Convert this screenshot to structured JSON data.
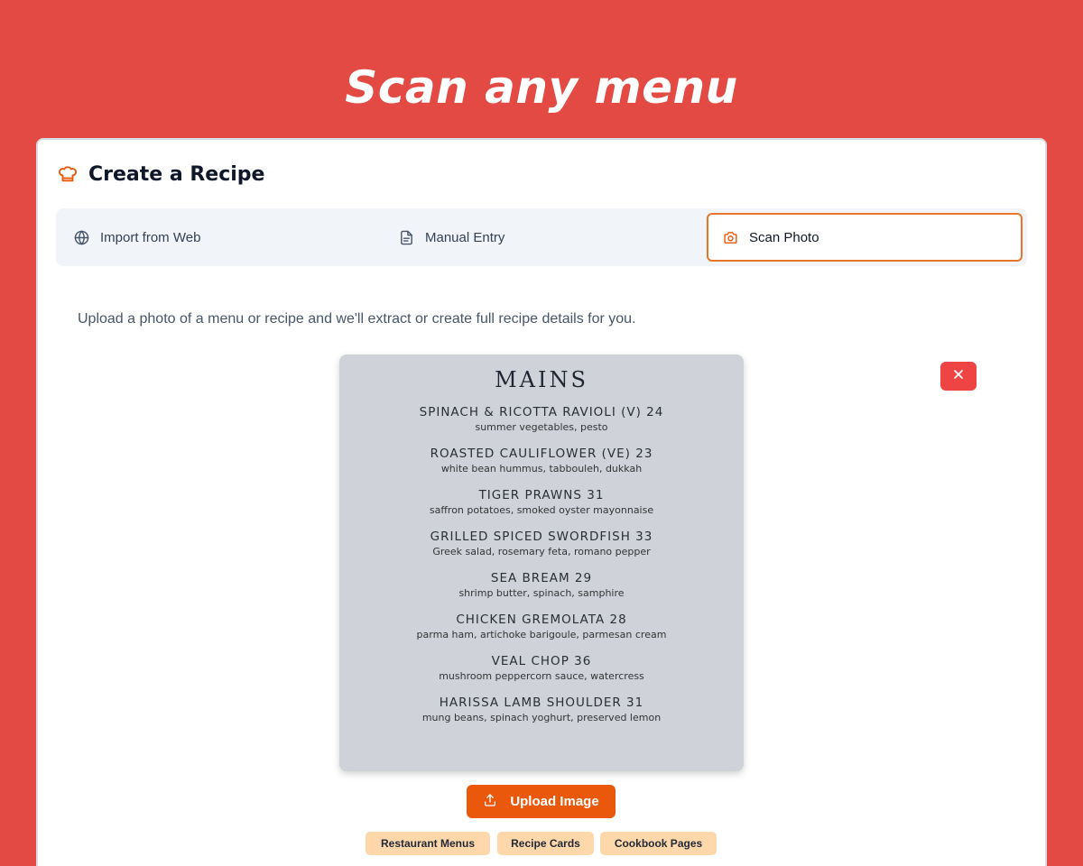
{
  "hero": {
    "title": "Scan any menu"
  },
  "card": {
    "title": "Create a Recipe",
    "icon": "chef-hat-icon",
    "accent_color": "#ea580c"
  },
  "tabs": [
    {
      "label": "Import from Web",
      "icon": "globe-icon",
      "active": false
    },
    {
      "label": "Manual Entry",
      "icon": "document-icon",
      "active": false
    },
    {
      "label": "Scan Photo",
      "icon": "camera-icon",
      "active": true
    }
  ],
  "intro_text": "Upload a photo of a menu or recipe and we'll extract or create full recipe details for you.",
  "menu_photo": {
    "heading": "MAINS",
    "dishes": [
      {
        "name": "SPINACH & RICOTTA RAVIOLI (V) 24",
        "desc": "summer vegetables, pesto"
      },
      {
        "name": "ROASTED CAULIFLOWER (VE) 23",
        "desc": "white bean hummus, tabbouleh, dukkah"
      },
      {
        "name": "TIGER PRAWNS 31",
        "desc": "saffron potatoes, smoked oyster mayonnaise"
      },
      {
        "name": "GRILLED SPICED SWORDFISH 33",
        "desc": "Greek salad, rosemary feta, romano pepper"
      },
      {
        "name": "SEA BREAM 29",
        "desc": "shrimp butter, spinach, samphire"
      },
      {
        "name": "CHICKEN GREMOLATA 28",
        "desc": "parma ham, artichoke barigoule, parmesan cream"
      },
      {
        "name": "VEAL CHOP 36",
        "desc": "mushroom peppercorn sauce, watercress"
      },
      {
        "name": "HARISSA LAMB SHOULDER 31",
        "desc": "mung beans, spinach yoghurt, preserved lemon"
      }
    ]
  },
  "remove_button": {
    "icon": "close-icon",
    "color": "#ef4444"
  },
  "upload_button": {
    "label": "Upload Image",
    "icon": "upload-icon"
  },
  "tags": [
    "Restaurant Menus",
    "Recipe Cards",
    "Cookbook Pages"
  ]
}
